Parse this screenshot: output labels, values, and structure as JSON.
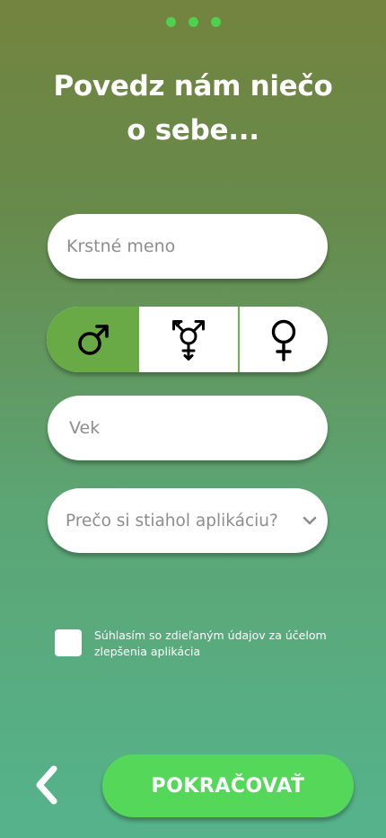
{
  "progress": {
    "steps": 3
  },
  "header": {
    "title_line1": "Povedz nám niečo",
    "title_line2": "o sebe..."
  },
  "form": {
    "first_name_placeholder": "Krstné meno",
    "gender_options": [
      "male",
      "transgender",
      "female"
    ],
    "gender_selected": "male",
    "age_placeholder": "Vek",
    "reason_placeholder": "Prečo si stiahol aplikáciu?",
    "consent_text": "Súhlasím so zdieľaným údajov za účelom zlepšenia aplikácia",
    "consent_checked": false
  },
  "footer": {
    "continue_label": "POKRAČOVAŤ"
  },
  "colors": {
    "accent": "#55d85a",
    "selected": "#6aaa46",
    "progress_dot": "#4fd14f"
  }
}
